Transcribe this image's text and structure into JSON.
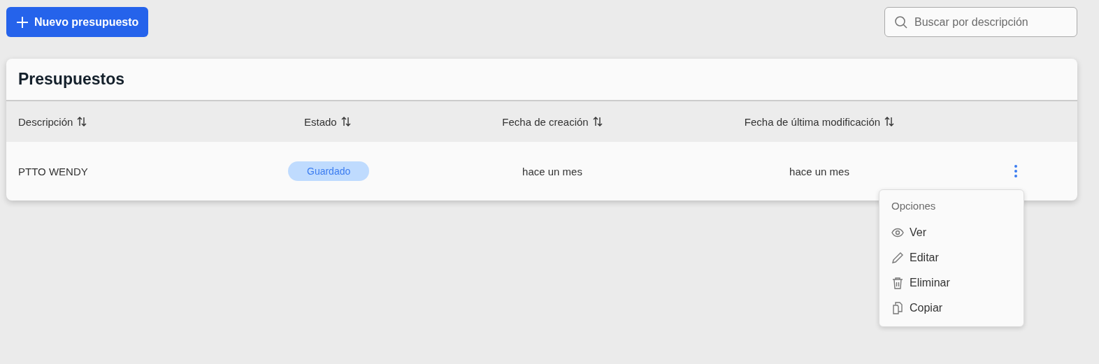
{
  "toolbar": {
    "new_button": "Nuevo presupuesto",
    "search": {
      "placeholder": "Buscar por descripción"
    }
  },
  "card": {
    "title": "Presupuestos",
    "columns": [
      {
        "label": "Descripción",
        "sortable": true
      },
      {
        "label": "Estado",
        "sortable": true
      },
      {
        "label": "Fecha de creación",
        "sortable": true
      },
      {
        "label": "Fecha de última modificación",
        "sortable": true
      }
    ],
    "rows": [
      {
        "description": "PTTO WENDY",
        "status": "Guardado",
        "created": "hace un mes",
        "modified": "hace un mes",
        "menu_open": true
      }
    ]
  },
  "menu": {
    "title": "Opciones",
    "items": [
      {
        "kind": "view",
        "label": "Ver"
      },
      {
        "kind": "edit",
        "label": "Editar"
      },
      {
        "kind": "delete",
        "label": "Eliminar"
      },
      {
        "kind": "copy",
        "label": "Copiar"
      }
    ]
  }
}
